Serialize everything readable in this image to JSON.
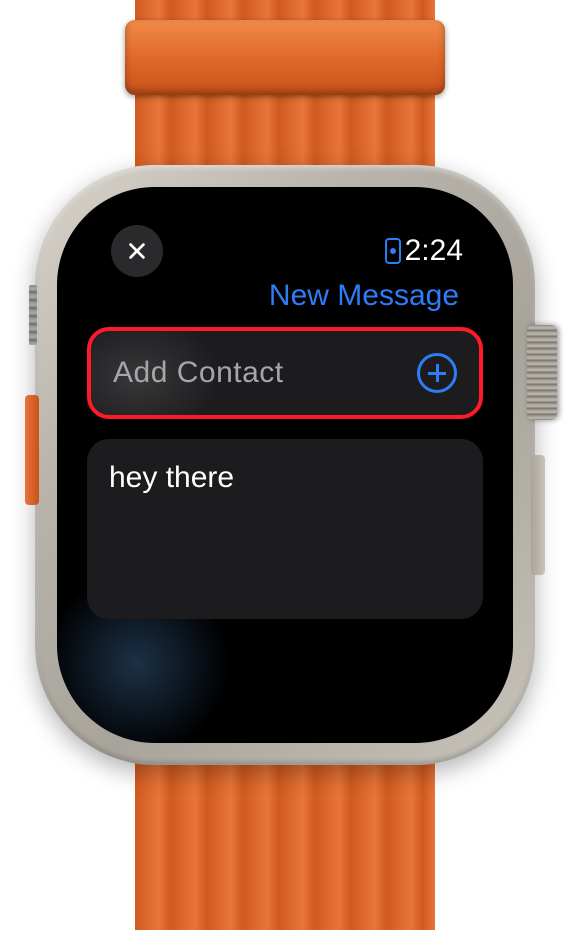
{
  "status": {
    "time": "2:24"
  },
  "header": {
    "title": "New Message"
  },
  "contact_row": {
    "label": "Add Contact",
    "highlighted": true
  },
  "message": {
    "text": "hey there"
  },
  "colors": {
    "accent": "#2e7cf6",
    "highlight_border": "#ff1a2a",
    "band": "#e8753a"
  }
}
